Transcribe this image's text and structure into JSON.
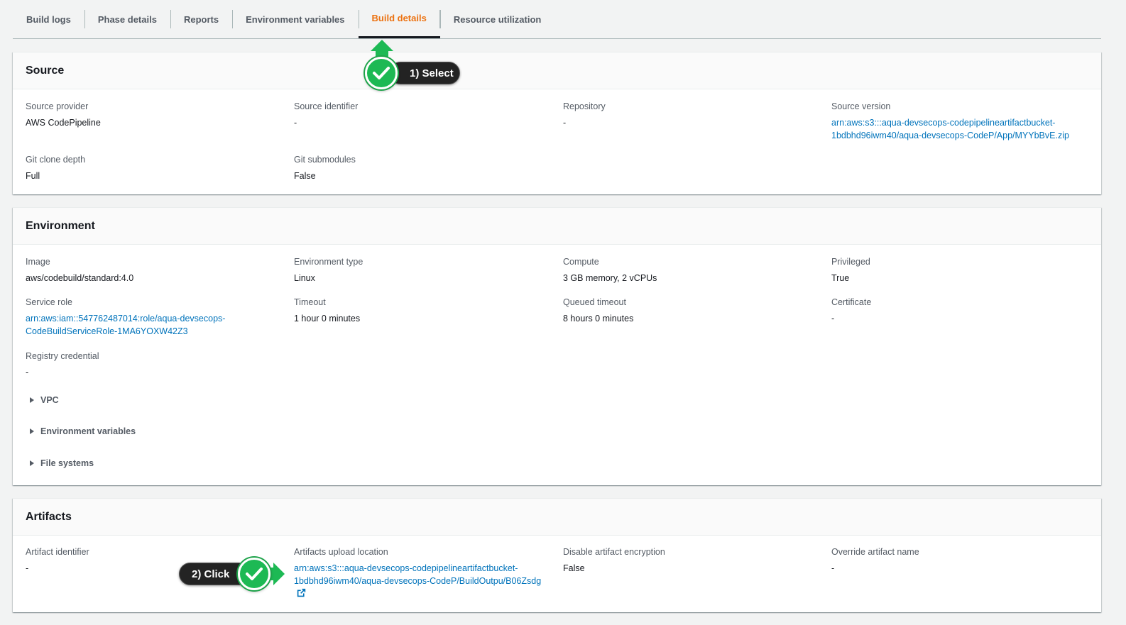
{
  "tabs": [
    {
      "label": "Build logs",
      "active": false
    },
    {
      "label": "Phase details",
      "active": false
    },
    {
      "label": "Reports",
      "active": false
    },
    {
      "label": "Environment variables",
      "active": false
    },
    {
      "label": "Build details",
      "active": true
    },
    {
      "label": "Resource utilization",
      "active": false
    }
  ],
  "colors": {
    "accent": "#ec7211",
    "link": "#0073bb",
    "callout_green": "#1db954"
  },
  "source": {
    "title": "Source",
    "source_provider": {
      "label": "Source provider",
      "value": "AWS CodePipeline"
    },
    "source_identifier": {
      "label": "Source identifier",
      "value": "-"
    },
    "repository": {
      "label": "Repository",
      "value": "-"
    },
    "source_version": {
      "label": "Source version",
      "value_line1": "arn:aws:s3:::aqua-devsecops-codepipelineartifactbucket-",
      "value_line2": "1bdbhd96iwm40/aqua-devsecops-CodeP/App/MYYbBvE.zip"
    },
    "git_clone_depth": {
      "label": "Git clone depth",
      "value": "Full"
    },
    "git_submodules": {
      "label": "Git submodules",
      "value": "False"
    }
  },
  "environment": {
    "title": "Environment",
    "image": {
      "label": "Image",
      "value": "aws/codebuild/standard:4.0"
    },
    "environment_type": {
      "label": "Environment type",
      "value": "Linux"
    },
    "compute": {
      "label": "Compute",
      "value": "3 GB memory, 2 vCPUs"
    },
    "privileged": {
      "label": "Privileged",
      "value": "True"
    },
    "service_role": {
      "label": "Service role",
      "value_line1": "arn:aws:iam::547762487014:role/aqua-devsecops-",
      "value_line2": "CodeBuildServiceRole-1MA6YOXW42Z3"
    },
    "timeout": {
      "label": "Timeout",
      "value": "1 hour 0 minutes"
    },
    "queued_timeout": {
      "label": "Queued timeout",
      "value": "8 hours 0 minutes"
    },
    "certificate": {
      "label": "Certificate",
      "value": "-"
    },
    "registry_credential": {
      "label": "Registry credential",
      "value": "-"
    },
    "expanders": [
      "VPC",
      "Environment variables",
      "File systems"
    ]
  },
  "artifacts": {
    "title": "Artifacts",
    "artifact_identifier": {
      "label": "Artifact identifier",
      "value": "-"
    },
    "upload_location": {
      "label": "Artifacts upload location",
      "value_line1": "arn:aws:s3:::aqua-devsecops-codepipelineartifactbucket-",
      "value_line2": "1bdbhd96iwm40/aqua-devsecops-CodeP/BuildOutpu/B06Zsdg"
    },
    "disable_encryption": {
      "label": "Disable artifact encryption",
      "value": "False"
    },
    "override_name": {
      "label": "Override artifact name",
      "value": "-"
    }
  },
  "callouts": {
    "step1": "1) Select",
    "step2": "2) Click"
  },
  "icons": {
    "external_link": "external-link-icon",
    "check": "check-icon",
    "caret": "caret-right-icon"
  }
}
